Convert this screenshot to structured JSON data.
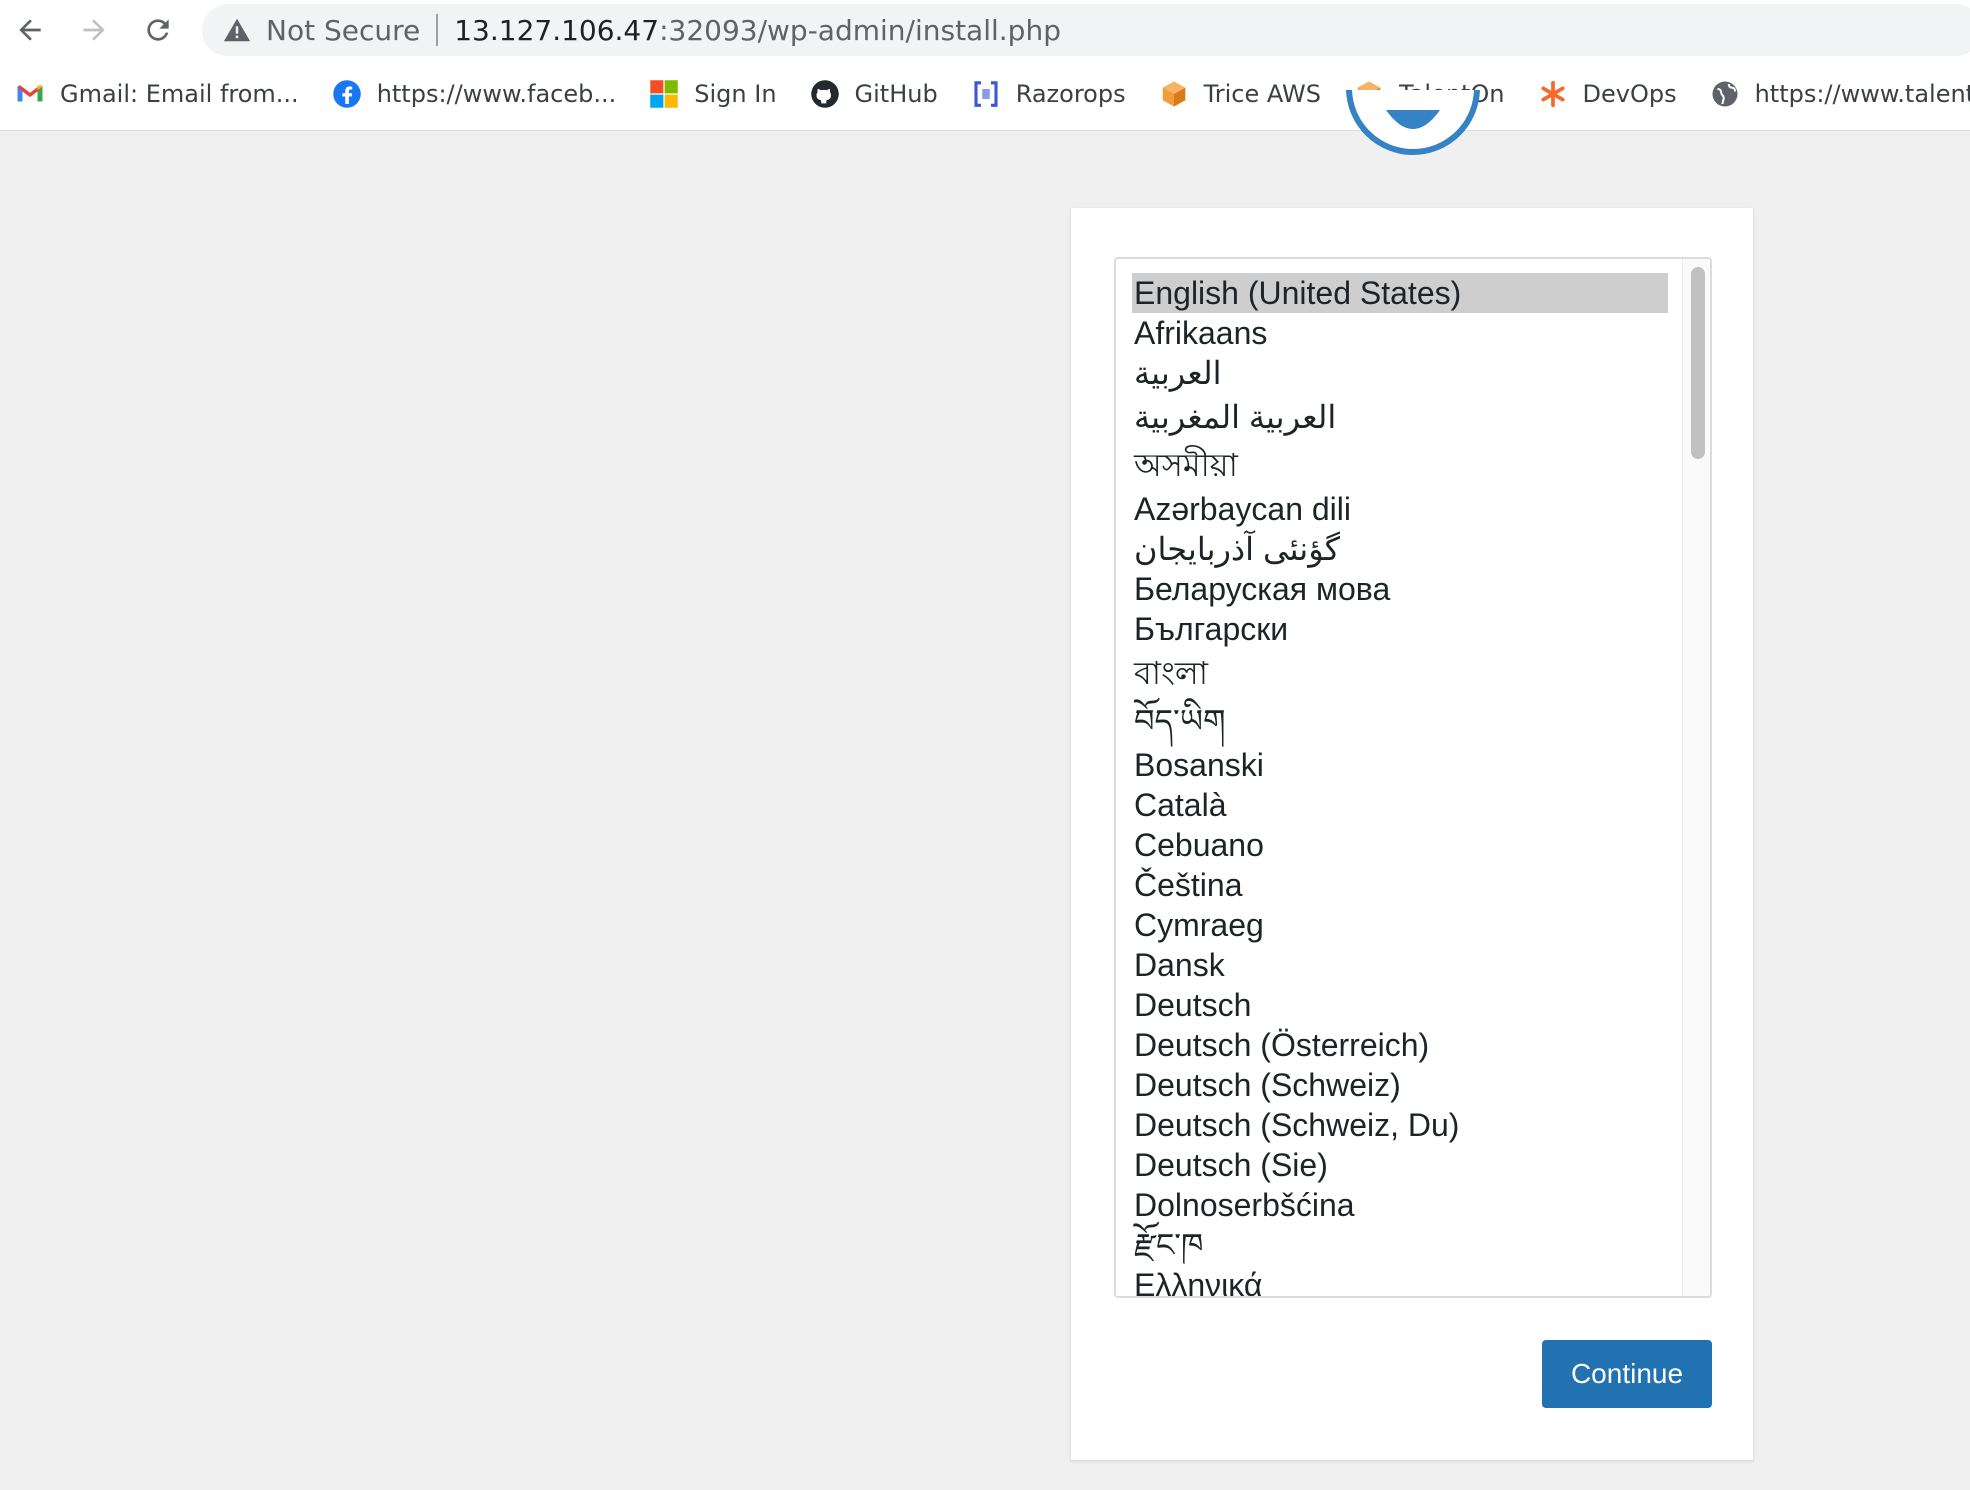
{
  "browser": {
    "security_label": "Not Secure",
    "url_host": "13.127.106.47",
    "url_rest": ":32093/wp-admin/install.php",
    "bookmarks": [
      {
        "label": "Gmail: Email from...",
        "icon": "gmail-icon"
      },
      {
        "label": "https://www.faceb...",
        "icon": "facebook-icon"
      },
      {
        "label": "Sign In",
        "icon": "microsoft-icon"
      },
      {
        "label": "GitHub",
        "icon": "github-icon"
      },
      {
        "label": "Razorops",
        "icon": "razorops-icon"
      },
      {
        "label": "Trice AWS",
        "icon": "aws-cube-icon"
      },
      {
        "label": "TalentOn",
        "icon": "aws-cube-icon"
      },
      {
        "label": "DevOps",
        "icon": "asterisk-icon"
      },
      {
        "label": "https://www.talent...",
        "icon": "globe-icon"
      }
    ]
  },
  "installer": {
    "languages": [
      "English (United States)",
      "Afrikaans",
      "العربية",
      "العربية المغربية",
      "অসমীয়া",
      "Azərbaycan dili",
      "گؤنئی آذربایجان",
      "Беларуская мова",
      "Български",
      "বাংলা",
      "བོད་ཡིག",
      "Bosanski",
      "Català",
      "Cebuano",
      "Čeština",
      "Cymraeg",
      "Dansk",
      "Deutsch",
      "Deutsch (Österreich)",
      "Deutsch (Schweiz)",
      "Deutsch (Schweiz, Du)",
      "Deutsch (Sie)",
      "Dolnoserbšćina",
      "རྫོང་ཁ",
      "Ελληνικά"
    ],
    "selected_language": "English (United States)",
    "continue_label": "Continue"
  },
  "colors": {
    "accent": "#2271b1",
    "selection": "#cecece",
    "background": "#f0f0f1"
  }
}
